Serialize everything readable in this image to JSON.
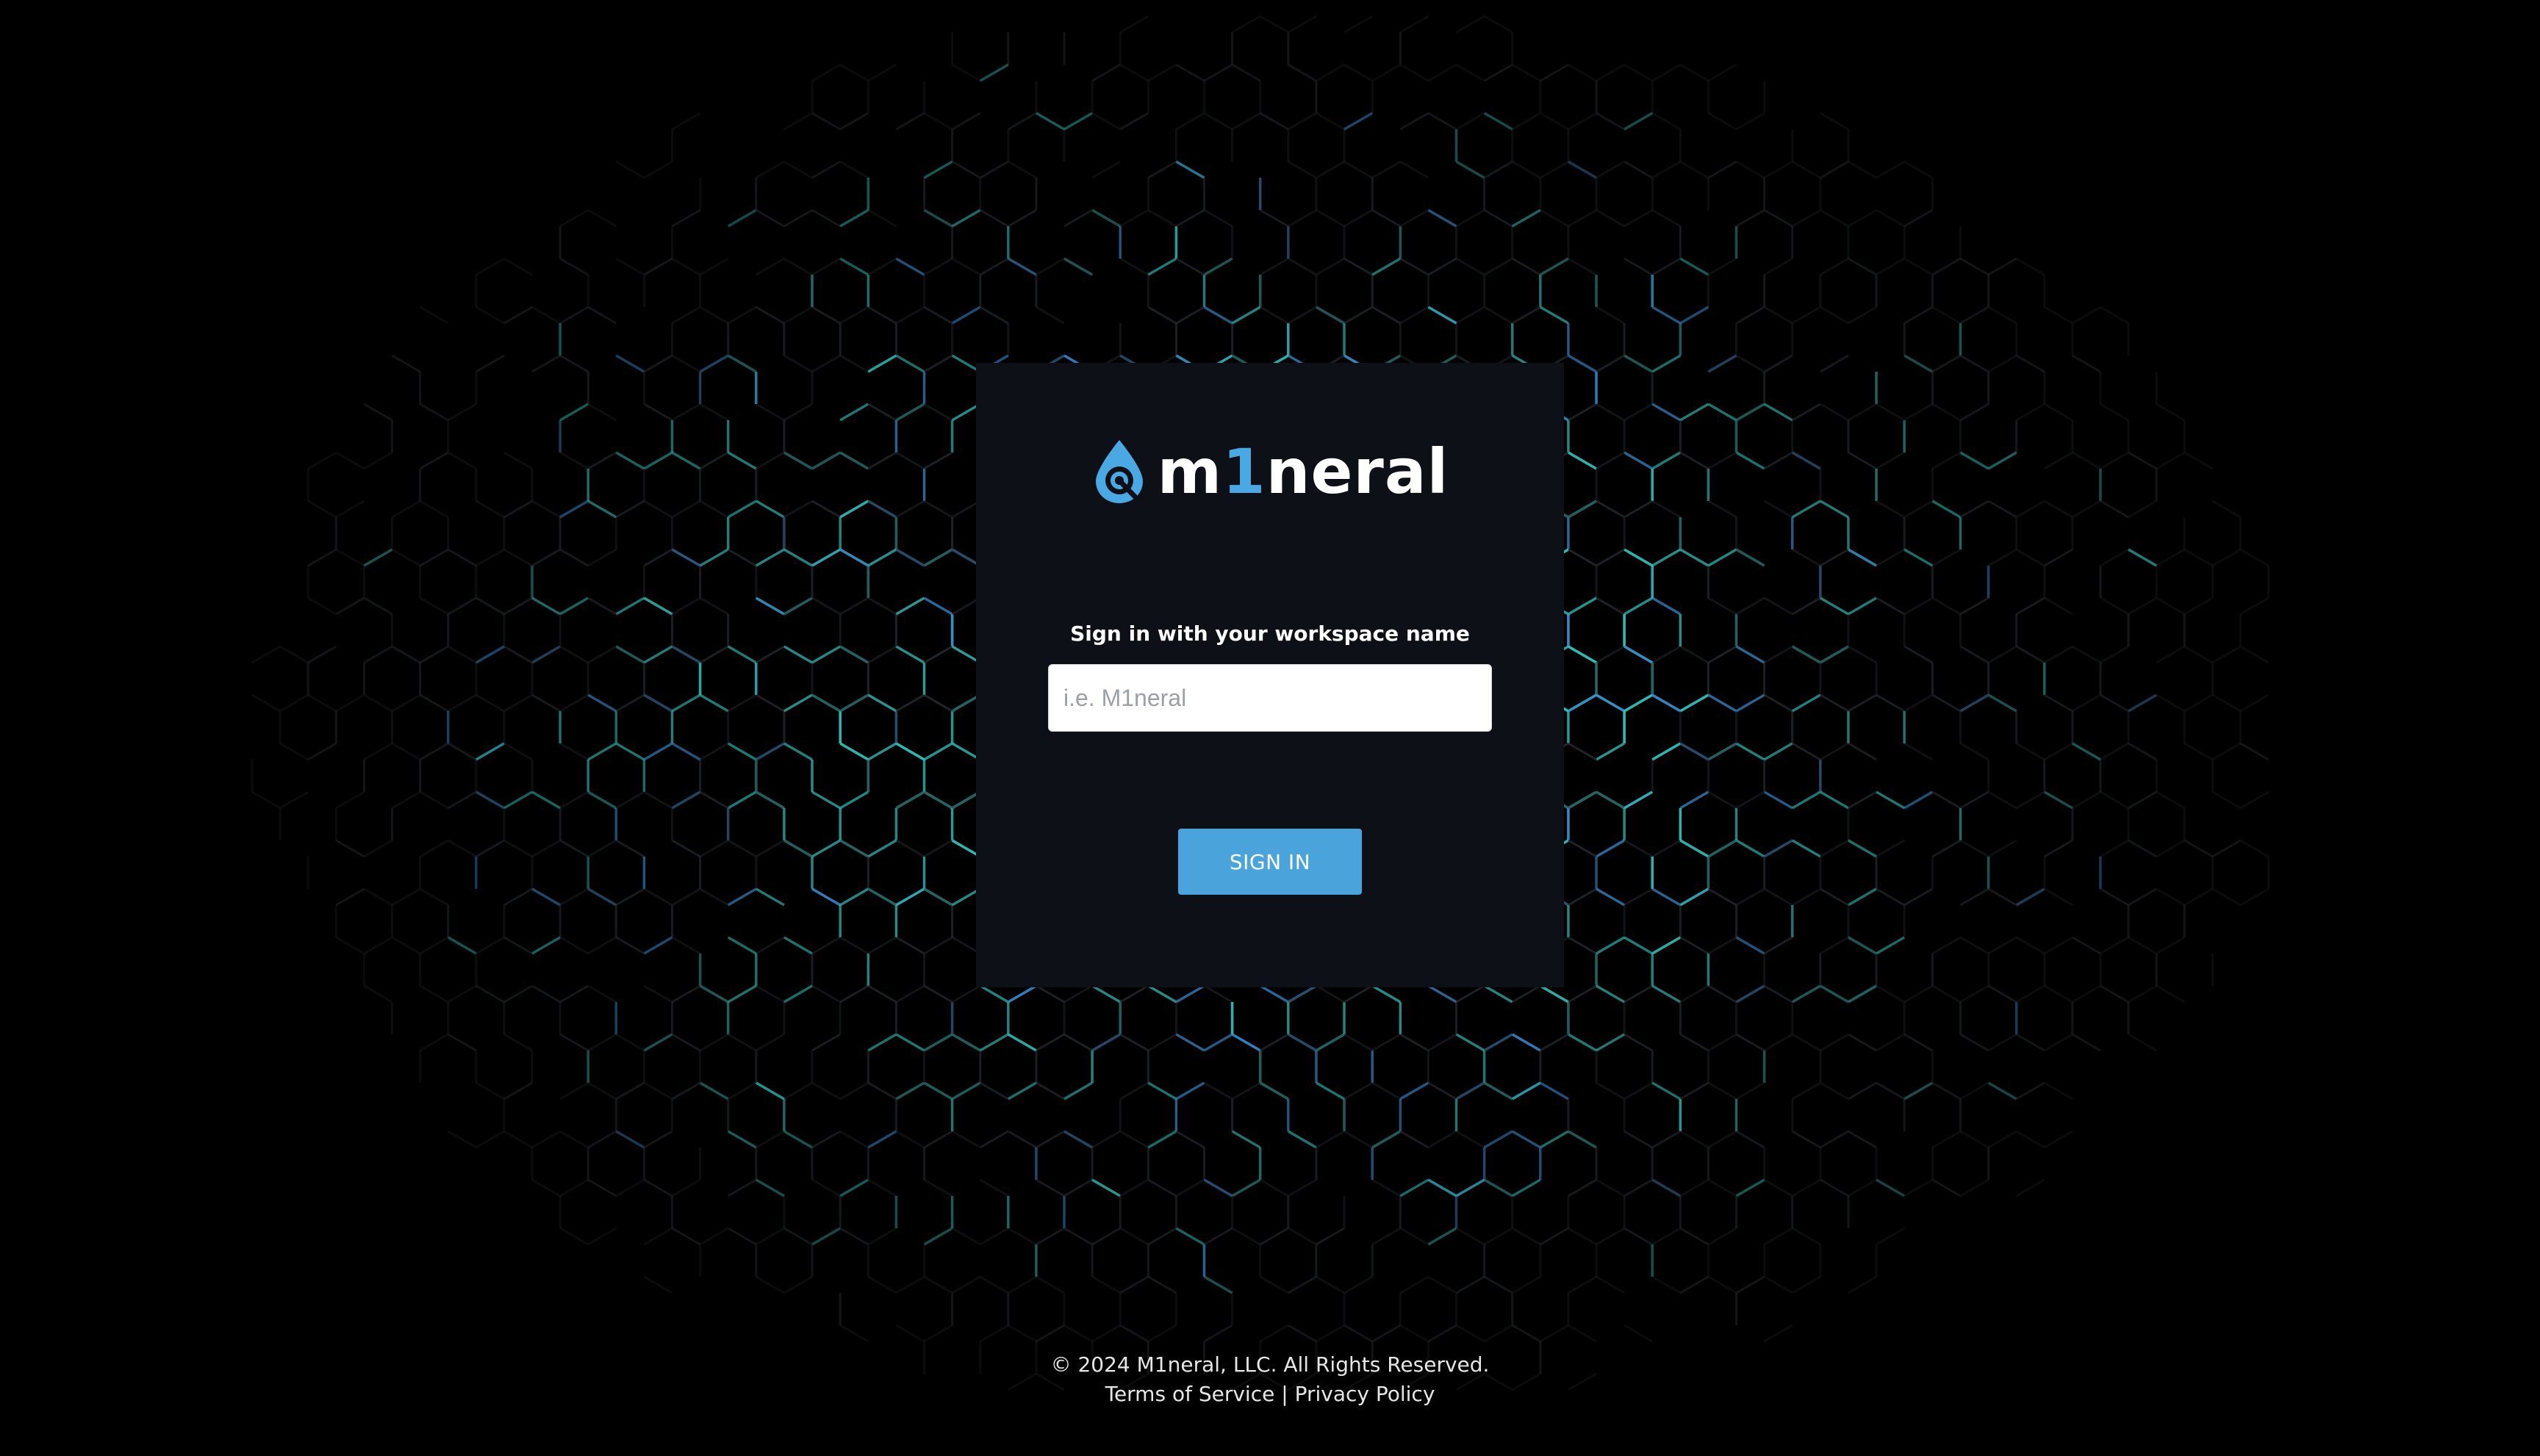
{
  "brand": {
    "name_prefix": "m",
    "name_accent": "1",
    "name_suffix": "neral",
    "accent_color": "#4aa8e2"
  },
  "signin": {
    "prompt": "Sign in with your workspace name",
    "input_placeholder": "i.e. M1neral",
    "input_value": "",
    "button_label": "SIGN IN",
    "button_color": "#4aa3db"
  },
  "footer": {
    "copyright": "© 2024 M1neral, LLC. All Rights Reserved.",
    "terms_label": "Terms of Service",
    "separator": "|",
    "privacy_label": "Privacy Policy"
  },
  "background": {
    "pattern_icon": "hexagon-network-pattern",
    "color_primary": "#35c7c0",
    "color_secondary": "#3a8fd6",
    "card_color": "#0d1016"
  }
}
